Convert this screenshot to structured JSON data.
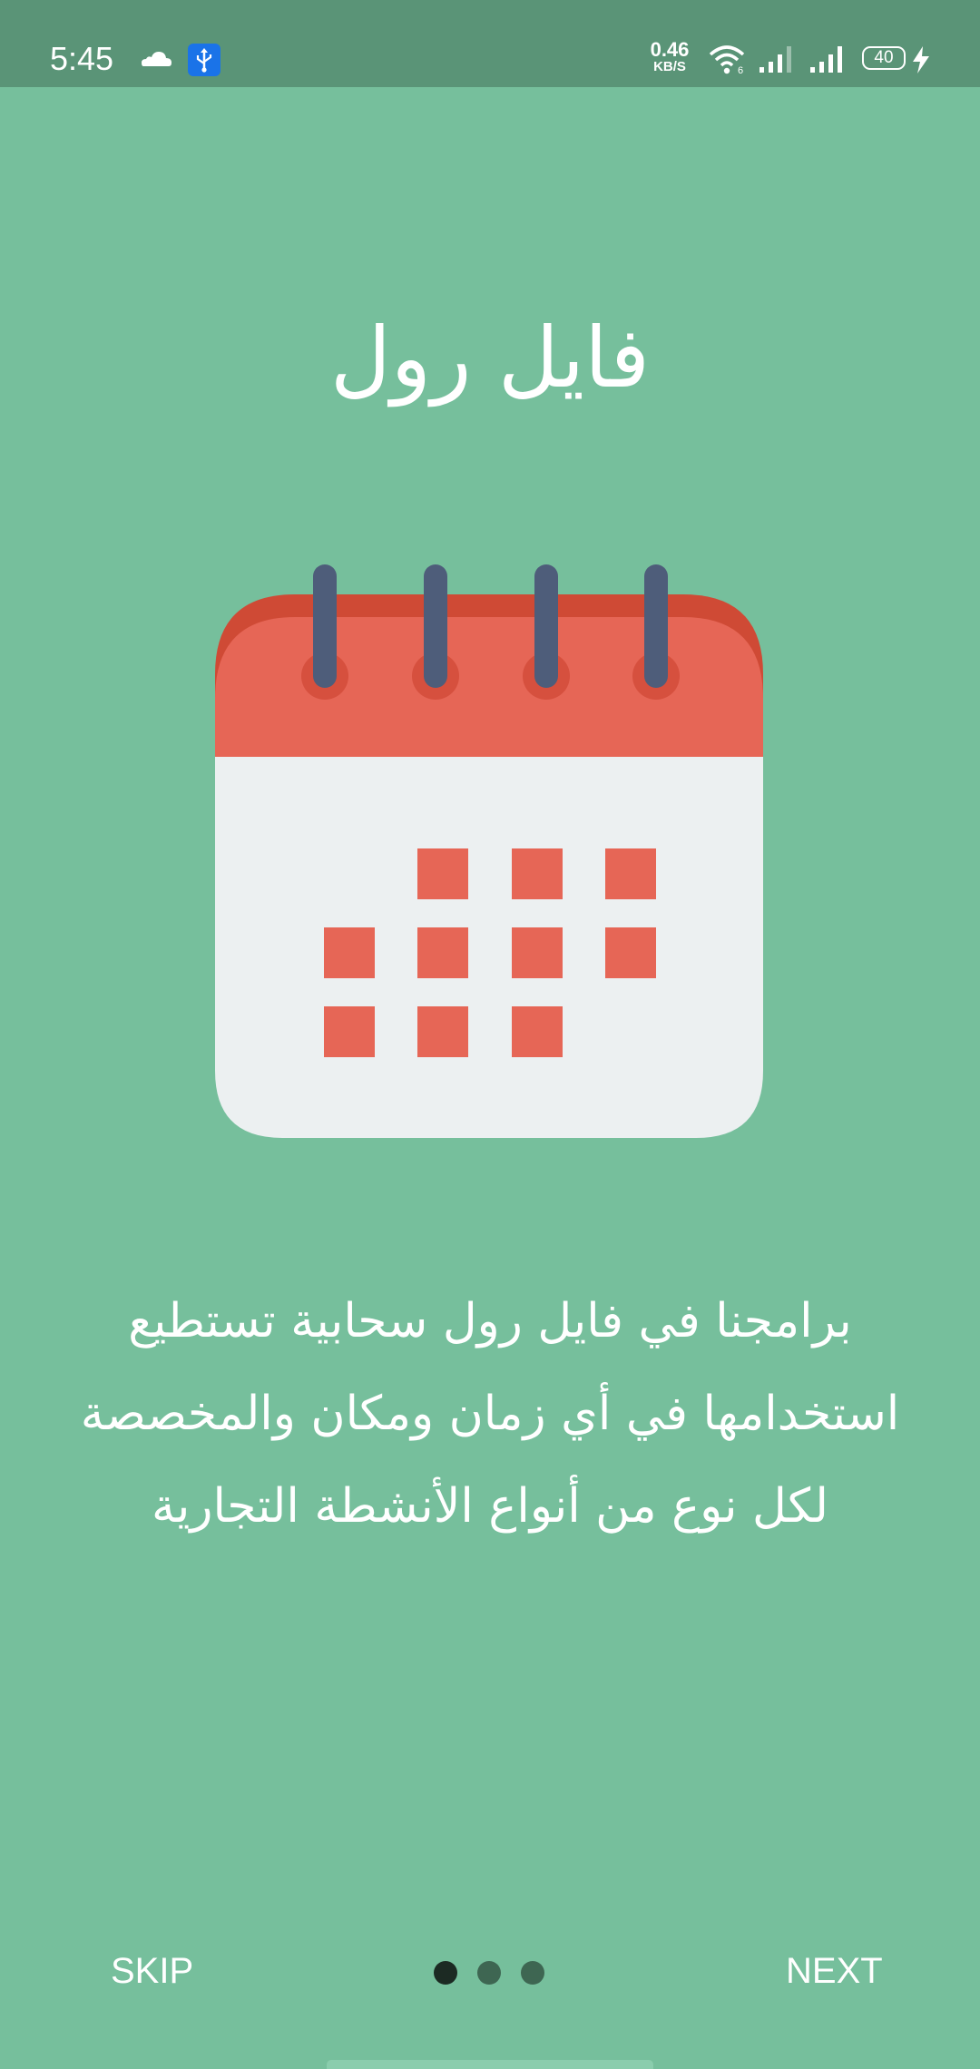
{
  "status_bar": {
    "time": "5:45",
    "net_speed_value": "0.46",
    "net_speed_unit": "KB/S",
    "battery_level": "40",
    "icons": [
      "cloud-icon",
      "usb-icon",
      "wifi-icon",
      "signal-icon",
      "signal-icon",
      "battery-icon",
      "charging-icon"
    ]
  },
  "onboarding": {
    "title": "فايل رول",
    "illustration": "calendar-icon",
    "description_lines": [
      "برامجنا في فايل رول سحابية تستطيع",
      "استخدامها في أي زمان ومكان والمخصصة",
      "لكل نوع من أنواع الأنشطة التجارية"
    ],
    "page_count": 3,
    "current_page": 1
  },
  "footer": {
    "skip_label": "SKIP",
    "next_label": "NEXT"
  },
  "colors": {
    "background": "#76bf9c",
    "status_bar": "#5a9477",
    "calendar_header": "#e66656",
    "calendar_body": "#ecf0f1",
    "calendar_rings": "#4e5d7a",
    "active_dot": "#1c2a23",
    "inactive_dot": "#3e6652"
  }
}
